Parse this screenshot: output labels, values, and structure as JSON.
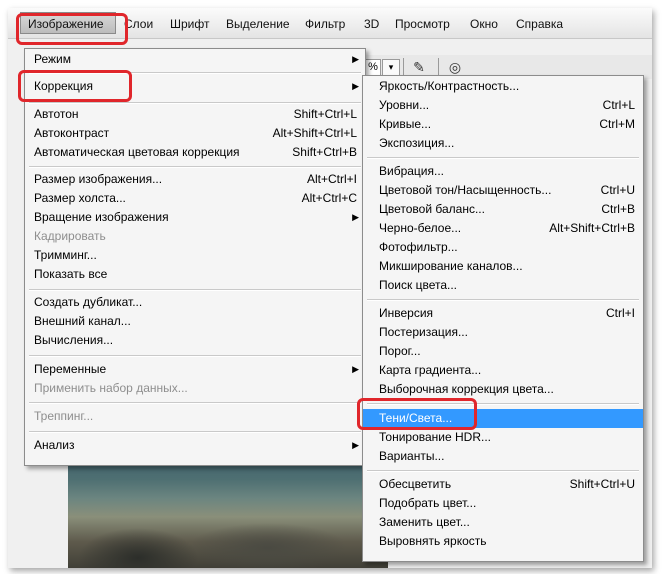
{
  "menubar": {
    "items": [
      "Изображение",
      "Слои",
      "Шрифт",
      "Выделение",
      "Фильтр",
      "3D",
      "Просмотр",
      "Окно",
      "Справка"
    ],
    "active": "Изображение"
  },
  "options_bar": {
    "percent": "%",
    "dropdown": "▾"
  },
  "image_menu": {
    "items": [
      {
        "label": "Режим",
        "submenu": true
      },
      {
        "label": "Коррекция",
        "submenu": true
      },
      {
        "label": "Автотон",
        "shortcut": "Shift+Ctrl+L"
      },
      {
        "label": "Автоконтраст",
        "shortcut": "Alt+Shift+Ctrl+L"
      },
      {
        "label": "Автоматическая цветовая коррекция",
        "shortcut": "Shift+Ctrl+B"
      },
      {
        "label": "Размер изображения...",
        "shortcut": "Alt+Ctrl+I"
      },
      {
        "label": "Размер холста...",
        "shortcut": "Alt+Ctrl+C"
      },
      {
        "label": "Вращение изображения",
        "submenu": true
      },
      {
        "label": "Кадрировать",
        "disabled": true
      },
      {
        "label": "Тримминг..."
      },
      {
        "label": "Показать все"
      },
      {
        "label": "Создать дубликат..."
      },
      {
        "label": "Внешний канал..."
      },
      {
        "label": "Вычисления..."
      },
      {
        "label": "Переменные",
        "submenu": true
      },
      {
        "label": "Применить набор данных...",
        "disabled": true
      },
      {
        "label": "Треппинг...",
        "disabled": true
      },
      {
        "label": "Анализ",
        "submenu": true
      }
    ]
  },
  "adjustments_menu": {
    "items": [
      {
        "label": "Яркость/Контрастность..."
      },
      {
        "label": "Уровни...",
        "shortcut": "Ctrl+L"
      },
      {
        "label": "Кривые...",
        "shortcut": "Ctrl+M"
      },
      {
        "label": "Экспозиция..."
      },
      {
        "label": "Вибрация..."
      },
      {
        "label": "Цветовой тон/Насыщенность...",
        "shortcut": "Ctrl+U"
      },
      {
        "label": "Цветовой баланс...",
        "shortcut": "Ctrl+B"
      },
      {
        "label": "Черно-белое...",
        "shortcut": "Alt+Shift+Ctrl+B"
      },
      {
        "label": "Фотофильтр..."
      },
      {
        "label": "Микширование каналов..."
      },
      {
        "label": "Поиск цвета..."
      },
      {
        "label": "Инверсия",
        "shortcut": "Ctrl+I"
      },
      {
        "label": "Постеризация..."
      },
      {
        "label": "Порог..."
      },
      {
        "label": "Карта градиента..."
      },
      {
        "label": "Выборочная коррекция цвета..."
      },
      {
        "label": "Тени/Света...",
        "selected": true
      },
      {
        "label": "Тонирование HDR..."
      },
      {
        "label": "Варианты..."
      },
      {
        "label": "Обесцветить",
        "shortcut": "Shift+Ctrl+U"
      },
      {
        "label": "Подобрать цвет..."
      },
      {
        "label": "Заменить цвет..."
      },
      {
        "label": "Выровнять яркость"
      }
    ]
  },
  "colors": {
    "highlight": "#3399ff",
    "annotation_red": "#e0262b"
  }
}
